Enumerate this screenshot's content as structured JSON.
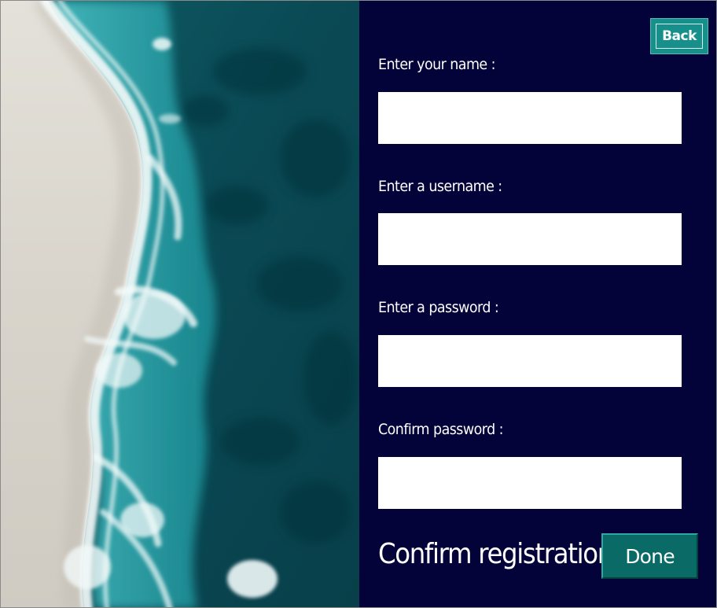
{
  "header": {
    "back_label": "Back"
  },
  "form": {
    "name_label": "Enter your name :",
    "name_value": "",
    "username_label": "Enter a username :",
    "username_value": "",
    "password_label": "Enter a password :",
    "password_value": "",
    "confirm_password_label": "Confirm password :",
    "confirm_password_value": ""
  },
  "footer": {
    "confirm_text": "Confirm registration",
    "done_label": "Done"
  },
  "colors": {
    "panel_background": "#03033a",
    "button_teal": "#178f8a",
    "done_teal": "#0a6b66",
    "input_background": "#ffffff",
    "text_color": "#ffffff"
  },
  "image": {
    "subject": "aerial-beach-ocean-photo"
  }
}
